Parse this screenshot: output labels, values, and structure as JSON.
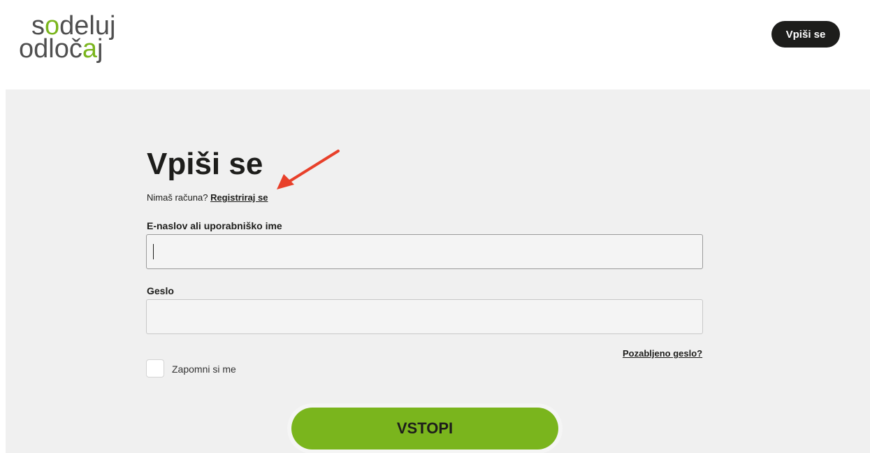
{
  "logo": {
    "line1_a": "s",
    "line1_b": "o",
    "line1_c": "deluj",
    "line2_a": "odloč",
    "line2_b": "a",
    "line2_c": "j"
  },
  "header": {
    "login_button": "Vpiši se"
  },
  "form": {
    "title": "Vpiši se",
    "no_account_text": "Nimaš računa?",
    "register_link": "Registriraj se",
    "email_label": "E-naslov ali uporabniško ime",
    "email_value": "",
    "password_label": "Geslo",
    "password_value": "",
    "forgot_link": "Pozabljeno geslo?",
    "remember_label": "Zapomni si me",
    "submit_label": "VSTOPI"
  },
  "colors": {
    "brand_green": "#7ab51d",
    "dark": "#1d1d1b",
    "panel_bg": "#f0f0f0",
    "annotation_arrow": "#e8402a"
  },
  "icons": {
    "annotation": "red-arrow-icon"
  }
}
